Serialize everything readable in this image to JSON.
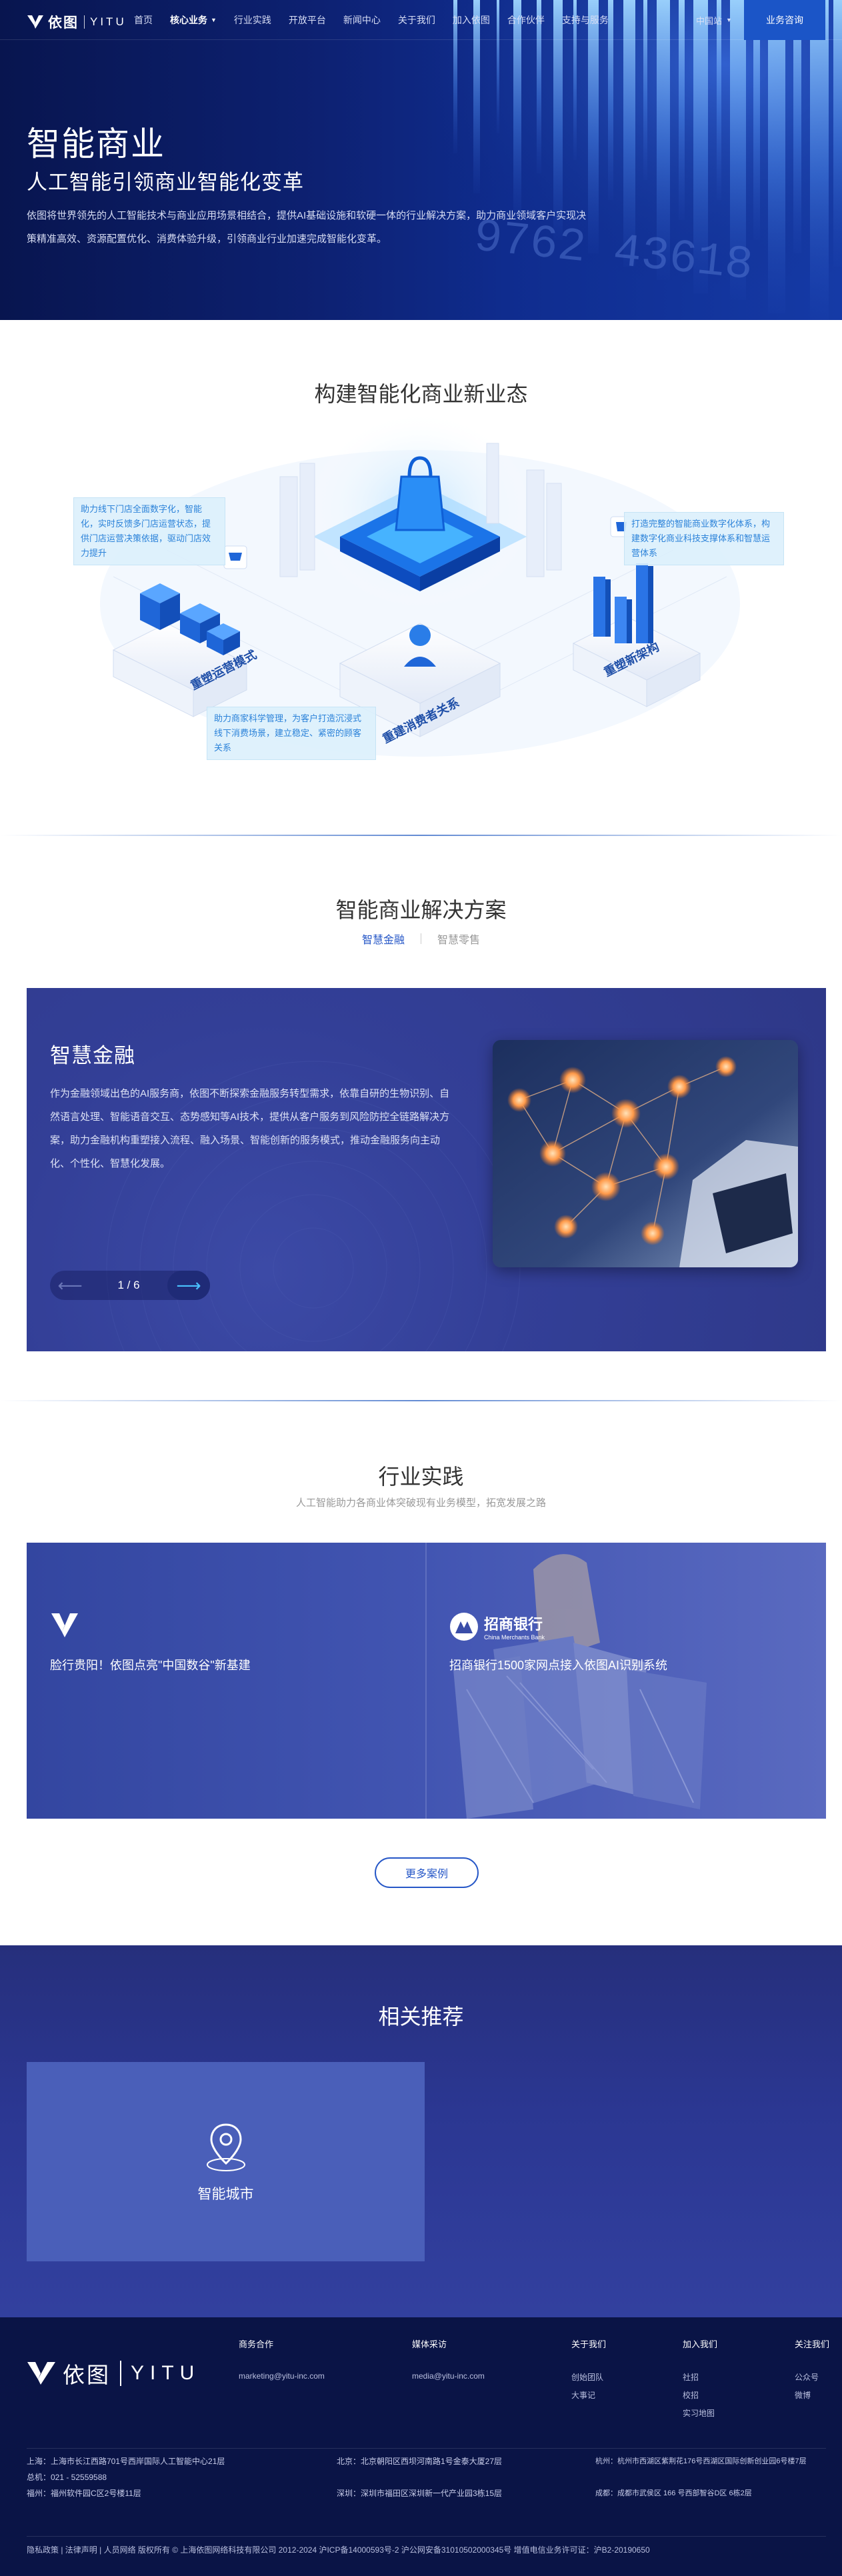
{
  "nav": {
    "logo_cn": "依图",
    "logo_en": "YITU",
    "items": [
      {
        "label": "首页"
      },
      {
        "label": "核心业务"
      },
      {
        "label": "行业实践"
      },
      {
        "label": "开放平台"
      },
      {
        "label": "新闻中心"
      },
      {
        "label": "关于我们"
      },
      {
        "label": "加入依图"
      },
      {
        "label": "合作伙伴"
      },
      {
        "label": "支持与服务"
      }
    ],
    "region": "中国站",
    "consult": "业务咨询"
  },
  "hero": {
    "title": "智能商业",
    "subtitle": "人工智能引领商业智能化变革",
    "desc": "依图将世界领先的人工智能技术与商业应用场景相结合，提供AI基础设施和软硬一体的行业解决方案，助力商业领域客户实现决策精准高效、资源配置优化、消费体验升级，引领商业行业加速完成智能化变革。",
    "bg_numbers": "9762 43618"
  },
  "ecosystem": {
    "title": "构建智能化商业新业态",
    "callouts": [
      "助力线下门店全面数字化，智能化，实时反馈多门店运营状态，提供门店运营决策依据，驱动门店效力提升",
      "打造完整的智能商业数字化体系，构建数字化商业科技支撑体系和智慧运营体系",
      "助力商家科学管理，为客户打造沉浸式线下消费场景，建立稳定、紧密的顾客关系"
    ],
    "labels": [
      "重塑运营模式",
      "重建消费者关系",
      "重塑新架构"
    ]
  },
  "solutions": {
    "title": "智能商业解决方案",
    "tabs": [
      "智慧金融",
      "智慧零售"
    ],
    "active_tab": 0,
    "card_title": "智慧金融",
    "card_desc": "作为金融领域出色的AI服务商，依图不断探索金融服务转型需求，依靠自研的生物识别、自然语言处理、智能语音交互、态势感知等AI技术，提供从客户服务到风险防控全链路解决方案，助力金融机构重塑接入流程、融入场景、智能创新的服务模式，推动金融服务向主动化、个性化、智慧化发展。",
    "pager": "1 / 6"
  },
  "cases": {
    "title": "行业实践",
    "subtitle": "人工智能助力各商业体突破现有业务模型，拓宽发展之路",
    "items": [
      {
        "caption": "脸行贵阳！依图点亮\"中国数谷\"新基建",
        "logo": "yitu-logo-icon"
      },
      {
        "caption": "招商银行1500家网点接入依图AI识别系统",
        "logo_cn": "招商银行",
        "logo_en": "China Merchants Bank"
      }
    ],
    "more": "更多案例"
  },
  "recommend": {
    "title": "相关推荐",
    "card": "智能城市"
  },
  "footer": {
    "logo_cn": "依图",
    "logo_en": "YITU",
    "cols": [
      {
        "head": "商务合作",
        "items": [
          "marketing@yitu-inc.com"
        ]
      },
      {
        "head": "媒体采访",
        "items": [
          "media@yitu-inc.com"
        ]
      },
      {
        "head": "关于我们",
        "items": [
          "创始团队",
          "大事记"
        ]
      },
      {
        "head": "加入我们",
        "items": [
          "社招",
          "校招",
          "实习地图"
        ]
      },
      {
        "head": "关注我们",
        "items": [
          "公众号",
          "微博"
        ]
      }
    ],
    "addr_sh": [
      "上海：上海市长江西路701号西岸国际人工智能中心21层",
      "总机：021 - 52559588",
      "福州：福州软件园C区2号楼11层"
    ],
    "addr_bj": [
      "北京：北京朝阳区西坝河南路1号金泰大厦27层",
      "",
      "深圳：深圳市福田区深圳新一代产业园3栋15层"
    ],
    "addr_hz": [
      "杭州：杭州市西湖区紫荆花176号西湖区国际创新创业园6号楼7层",
      "",
      "成都：成都市武侯区 166 号西部智谷D区 6栋2层"
    ],
    "copyright": "隐私政策 | 法律声明 | 人员网络 版权所有 © 上海依图网络科技有限公司 2012-2024 沪ICP备14000593号-2 沪公网安备31010502000345号 增值电信业务许可证：沪B2-20190650"
  }
}
